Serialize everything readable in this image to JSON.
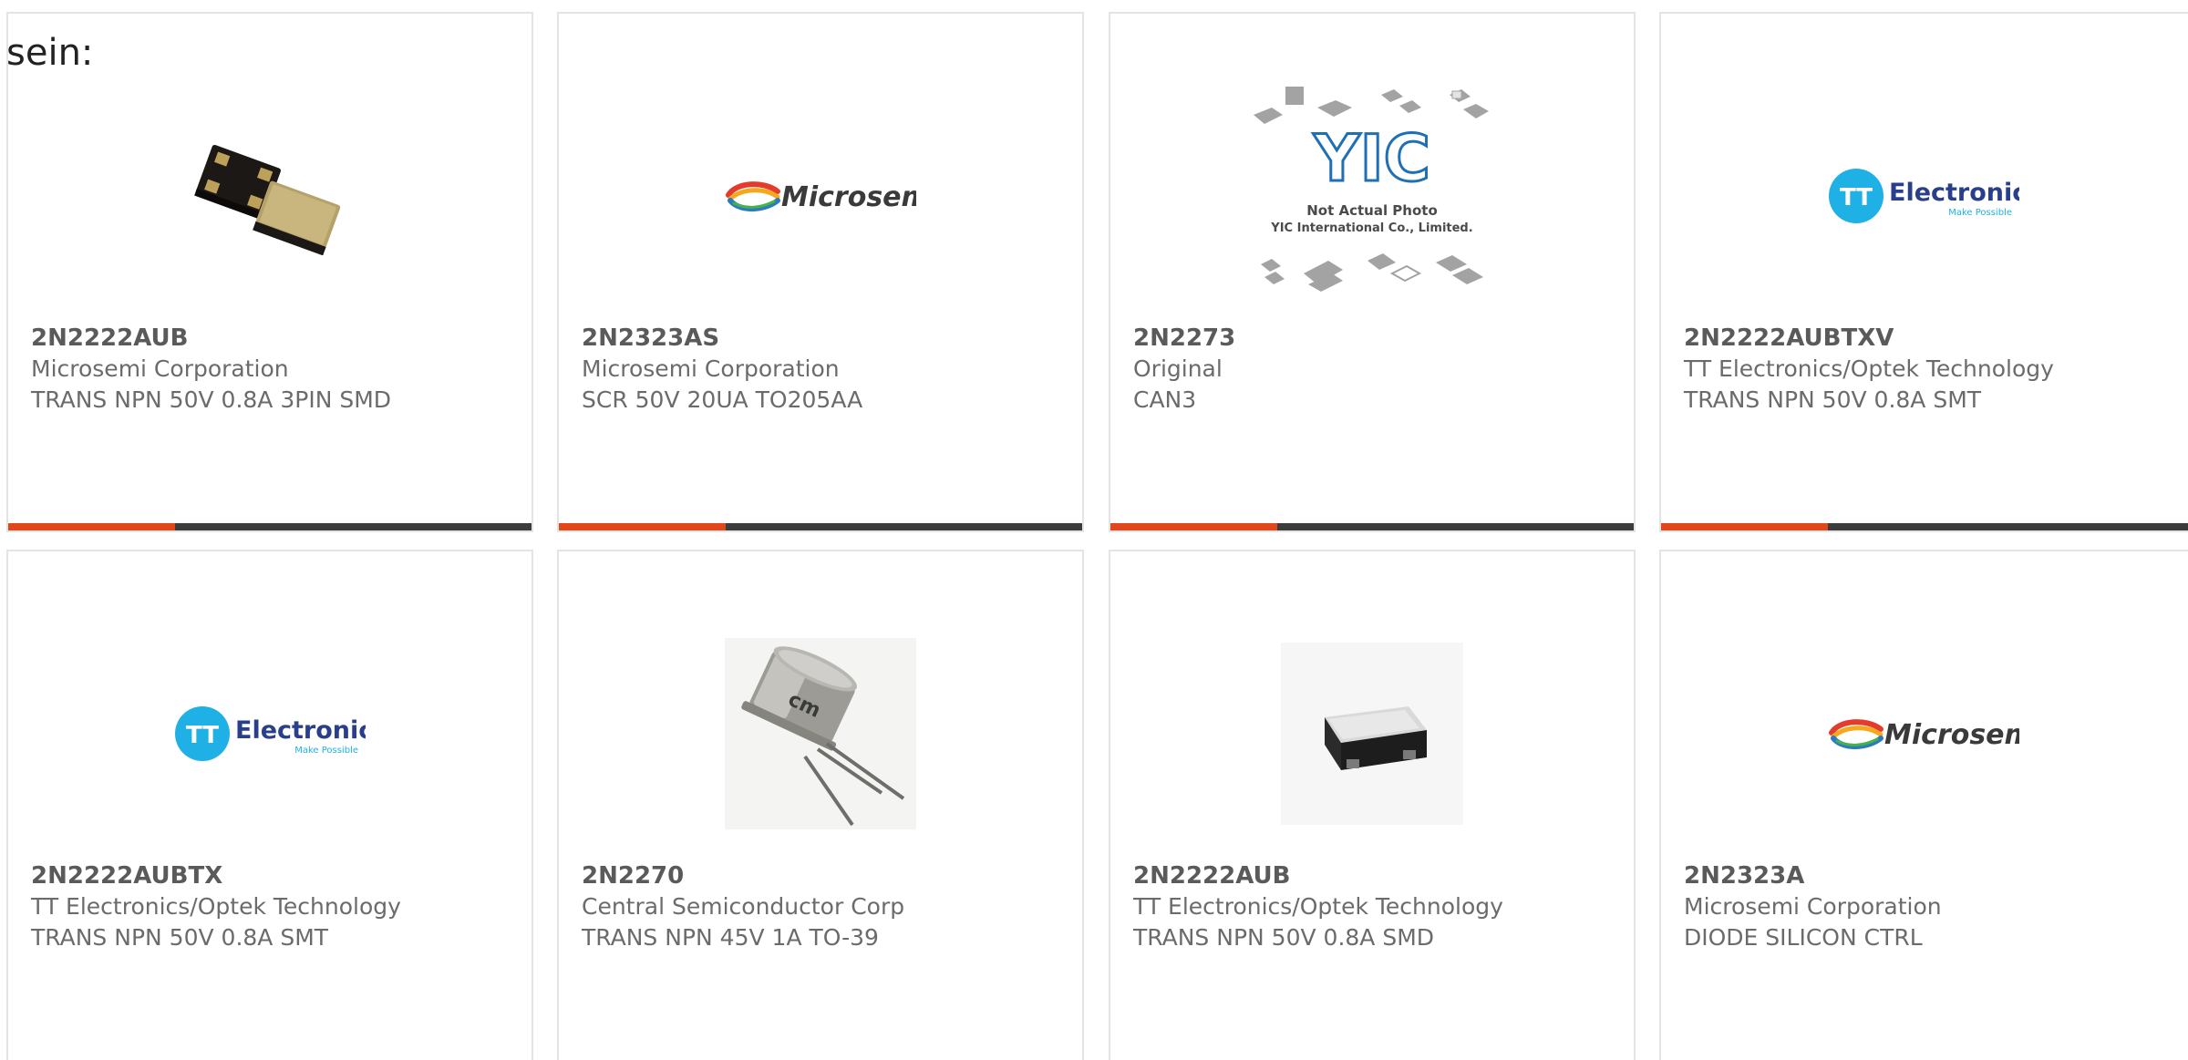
{
  "heading": "sein:",
  "colors": {
    "accent": "#e1471c",
    "bar": "#3c3c3c",
    "card_border": "#e4e4e4",
    "part_number": "#5a5a5a",
    "text": "#6b6b6b",
    "tt_blue": "#1fb1e6"
  },
  "products": [
    {
      "part_number": "2N2222AUB",
      "manufacturer": "Microsemi Corporation",
      "description": "TRANS NPN 50V 0.8A 3PIN SMD",
      "image": "smd-package-photo"
    },
    {
      "part_number": "2N2323AS",
      "manufacturer": "Microsemi Corporation",
      "description": "SCR 50V 20UA TO205AA",
      "image": "microsemi-logo",
      "logo_text": "Microsemi"
    },
    {
      "part_number": "2N2273",
      "manufacturer": "Original",
      "description": "CAN3",
      "image": "yic-placeholder",
      "logo_text": "YIC",
      "caption_line1": "Not Actual Photo",
      "caption_line2": "YIC International Co., Limited."
    },
    {
      "part_number": "2N2222AUBTXV",
      "manufacturer": "TT Electronics/Optek Technology",
      "description": "TRANS NPN 50V 0.8A SMT",
      "image": "tt-electronics-logo",
      "logo_mark": "TT",
      "logo_text": "Electronics",
      "logo_tagline": "Make Possible"
    },
    {
      "part_number": "2N2222AUBTX",
      "manufacturer": "TT Electronics/Optek Technology",
      "description": "TRANS NPN 50V 0.8A SMT",
      "image": "tt-electronics-logo",
      "logo_mark": "TT",
      "logo_text": "Electronics",
      "logo_tagline": "Make Possible"
    },
    {
      "part_number": "2N2270",
      "manufacturer": "Central Semiconductor Corp",
      "description": "TRANS NPN 45V 1A TO-39",
      "image": "to39-can-photo"
    },
    {
      "part_number": "2N2222AUB",
      "manufacturer": "TT Electronics/Optek Technology",
      "description": "TRANS NPN 50V 0.8A SMD",
      "image": "smd-chip-photo"
    },
    {
      "part_number": "2N2323A",
      "manufacturer": "Microsemi Corporation",
      "description": "DIODE SILICON CTRL",
      "image": "microsemi-logo",
      "logo_text": "Microsemi"
    }
  ]
}
